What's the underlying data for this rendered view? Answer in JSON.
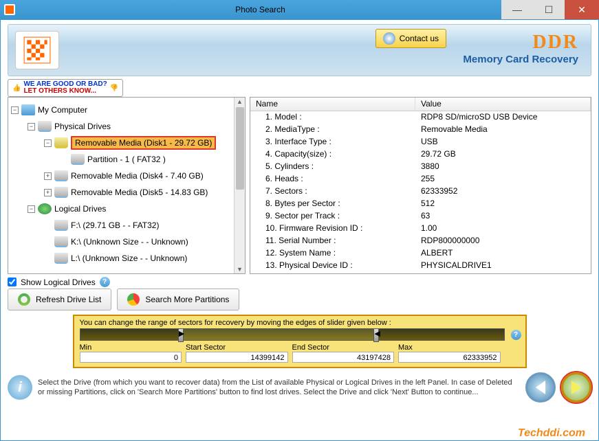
{
  "window": {
    "title": "Photo Search"
  },
  "banner": {
    "contact_label": "Contact us",
    "brand": "DDR",
    "brand_sub": "Memory Card Recovery"
  },
  "feedback": {
    "line1": "WE ARE GOOD OR BAD?",
    "line2": "LET OTHERS KNOW..."
  },
  "tree": {
    "root": "My Computer",
    "physical_label": "Physical Drives",
    "logical_label": "Logical Drives",
    "physical": [
      {
        "label": "Removable Media (Disk1 - 29.72 GB)",
        "selected": true,
        "expanded": true,
        "child": "Partition - 1 ( FAT32 )"
      },
      {
        "label": "Removable Media (Disk4 - 7.40 GB)",
        "selected": false,
        "expanded": false
      },
      {
        "label": "Removable Media (Disk5 - 14.83 GB)",
        "selected": false,
        "expanded": false
      }
    ],
    "logical": [
      {
        "label": "F:\\ (29.71 GB  -  - FAT32)"
      },
      {
        "label": "K:\\ (Unknown Size  -  - Unknown)"
      },
      {
        "label": "L:\\ (Unknown Size  -  - Unknown)"
      }
    ]
  },
  "details": {
    "col_name": "Name",
    "col_value": "Value",
    "rows": [
      {
        "k": "1. Model :",
        "v": "RDP8 SD/microSD USB Device"
      },
      {
        "k": "2. MediaType :",
        "v": "Removable Media"
      },
      {
        "k": "3. Interface Type :",
        "v": "USB"
      },
      {
        "k": "4. Capacity(size) :",
        "v": "29.72 GB"
      },
      {
        "k": "5. Cylinders :",
        "v": "3880"
      },
      {
        "k": "6. Heads :",
        "v": "255"
      },
      {
        "k": "7. Sectors :",
        "v": "62333952"
      },
      {
        "k": "8. Bytes per Sector :",
        "v": "512"
      },
      {
        "k": "9. Sector per Track :",
        "v": "63"
      },
      {
        "k": "10. Firmware Revision ID :",
        "v": "1.00"
      },
      {
        "k": "11. Serial Number :",
        "v": "RDP800000000"
      },
      {
        "k": "12. System Name :",
        "v": "ALBERT"
      },
      {
        "k": "13. Physical Device ID :",
        "v": "PHYSICALDRIVE1"
      }
    ]
  },
  "controls": {
    "show_logical": "Show Logical Drives",
    "refresh": "Refresh Drive List",
    "search_more": "Search More Partitions"
  },
  "slider": {
    "hint": "You can change the range of sectors for recovery by moving the edges of slider given below :",
    "min_label": "Min",
    "start_label": "Start Sector",
    "end_label": "End Sector",
    "max_label": "Max",
    "min": "0",
    "start": "14399142",
    "end": "43197428",
    "max": "62333952",
    "start_pct": 23.1,
    "end_pct": 69.3
  },
  "footer": {
    "text": "Select the Drive (from which you want to recover data) from the List of available Physical or Logical Drives in the left Panel. In case of Deleted or missing Partitions, click on 'Search More Partitions' button to find lost drives. Select the Drive and click 'Next' Button to continue..."
  },
  "watermark": "Techddi.com"
}
